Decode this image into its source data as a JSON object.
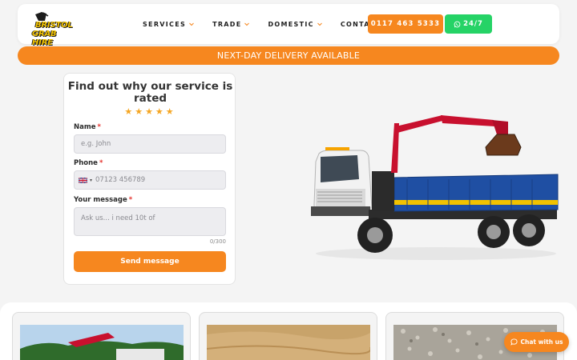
{
  "header": {
    "logo": {
      "line1": "BRISTOL",
      "line2": "GRAB HIRE"
    },
    "nav": [
      {
        "label": "SERVICES",
        "has_dropdown": true
      },
      {
        "label": "TRADE",
        "has_dropdown": true
      },
      {
        "label": "DOMESTIC",
        "has_dropdown": true
      },
      {
        "label": "CONTACT",
        "has_dropdown": false
      }
    ],
    "phone_label": "0117 463 5333",
    "whatsapp_label": "24/7"
  },
  "banner": {
    "text": "NEXT-DAY DELIVERY AVAILABLE"
  },
  "form": {
    "title": "Find out why our service is rated",
    "stars": "★★★★★",
    "rating_stars": 5,
    "name": {
      "label": "Name",
      "required": "*",
      "placeholder": "e.g. John"
    },
    "phone": {
      "label": "Phone",
      "required": "*",
      "placeholder": "07123 456789"
    },
    "message": {
      "label": "Your message",
      "required": "*",
      "placeholder": "Ask us... i need 10t of",
      "counter": "0/300"
    },
    "send_label": "Send message"
  },
  "chat": {
    "label": "Chat with us"
  },
  "colors": {
    "accent": "#f6871f",
    "whatsapp": "#25d366",
    "star": "#f5a623",
    "required": "#e5322d"
  }
}
